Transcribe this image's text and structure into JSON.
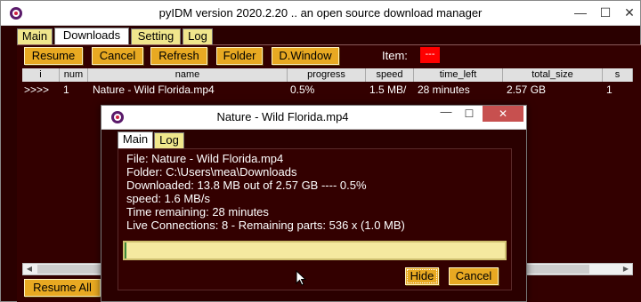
{
  "window": {
    "title": "pyIDM version 2020.2.20 .. an open source download manager",
    "controls": {
      "minimize": "—",
      "maximize": "☐",
      "close": "✕"
    }
  },
  "tabs": [
    {
      "label": "Main"
    },
    {
      "label": "Downloads",
      "active": true
    },
    {
      "label": "Setting"
    },
    {
      "label": "Log"
    }
  ],
  "toolbar": {
    "resume": "Resume",
    "cancel": "Cancel",
    "refresh": "Refresh",
    "folder": "Folder",
    "dwindow": "D.Window",
    "item_label": "Item:",
    "item_value": "---"
  },
  "table": {
    "headers": [
      "i",
      "num",
      "name",
      "progress",
      "speed",
      "time_left",
      "total_size",
      "s"
    ],
    "rows": [
      {
        "i": ">>>>",
        "num": "1",
        "name": "Nature - Wild Florida.mp4",
        "progress": "0.5%",
        "speed": "1.5 MB/",
        "time_left": "28 minutes",
        "total_size": "2.57 GB",
        "status": "1"
      }
    ]
  },
  "bottom": {
    "resume_all": "Resume All"
  },
  "dialog": {
    "title": "Nature - Wild Florida.mp4",
    "controls": {
      "minimize": "—",
      "maximize": "☐",
      "close": "✕"
    },
    "tabs": [
      {
        "label": "Main",
        "active": true
      },
      {
        "label": "Log"
      }
    ],
    "info": [
      "File: Nature - Wild Florida.mp4",
      "Folder: C:\\Users\\mea\\Downloads",
      "Downloaded:    13.8 MB out of 2.57 GB ----  0.5%",
      "speed: 1.6 MB/s",
      "Time remaining: 28 minutes",
      "Live Connections: 8 - Remaining parts: 536 x (1.0 MB)"
    ],
    "progress_fraction": 0.005,
    "buttons": {
      "hide": "Hide",
      "cancel": "Cancel"
    }
  },
  "colors": {
    "background": "#330000",
    "button": "#e8a922",
    "tab": "#f0e68c",
    "item_indicator": "#ff0000",
    "progress_bg": "#f5e9a0"
  }
}
